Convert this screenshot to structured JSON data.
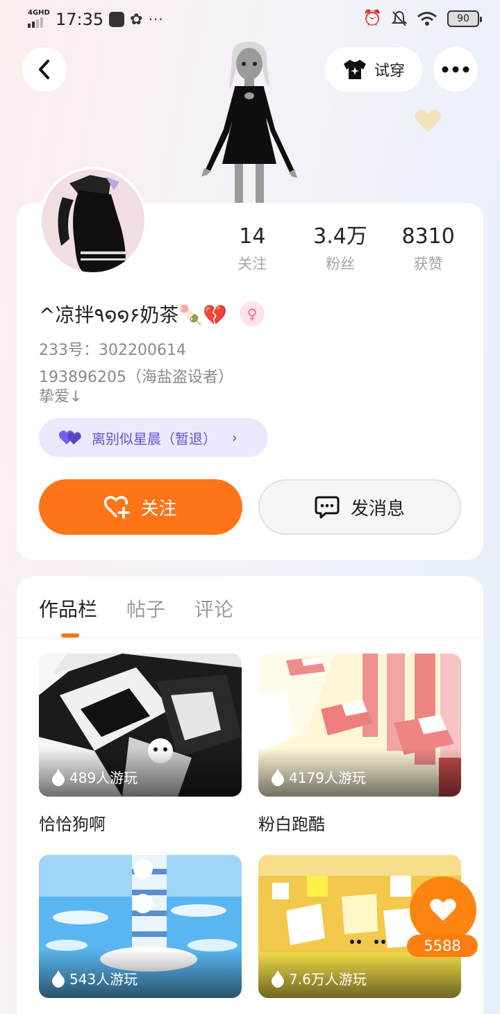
{
  "status_bar": {
    "network": "4GHD",
    "time": "17:35",
    "more": "···",
    "battery": "90"
  },
  "header": {
    "tryon_label": "试穿"
  },
  "profile": {
    "stats": [
      {
        "value": "14",
        "label": "关注"
      },
      {
        "value": "3.4万",
        "label": "粉丝"
      },
      {
        "value": "8310",
        "label": "获赞"
      }
    ],
    "nickname": "^凉拌٩໑໑۶奶茶🍡💔",
    "gender_symbol": "♀",
    "uid_line": "233号：302200614",
    "bio_line1": "193896205（海盐盗设者）",
    "bio_line2": "挚爱↓",
    "cp_tag": "离别似星晨（暂退）",
    "follow_label": "关注",
    "message_label": "发消息"
  },
  "tabs": [
    {
      "label": "作品栏",
      "active": true
    },
    {
      "label": "帖子",
      "active": false
    },
    {
      "label": "评论",
      "active": false
    }
  ],
  "works": [
    {
      "title": "恰恰狗啊",
      "plays": "489人游玩",
      "theme": "monochrome"
    },
    {
      "title": "粉白跑酷",
      "plays": "4179人游玩",
      "theme": "pink-white"
    },
    {
      "title": "",
      "plays": "543人游玩",
      "theme": "sky-blue"
    },
    {
      "title": "",
      "plays": "7.6万人游玩",
      "theme": "yellow"
    }
  ],
  "like_fab": {
    "count": "5588"
  },
  "colors": {
    "accent": "#fe7418",
    "cp_tag_text": "#6a52d4",
    "cp_tag_bg": "#ebe9fb",
    "muted_text": "#8a8a8a"
  }
}
